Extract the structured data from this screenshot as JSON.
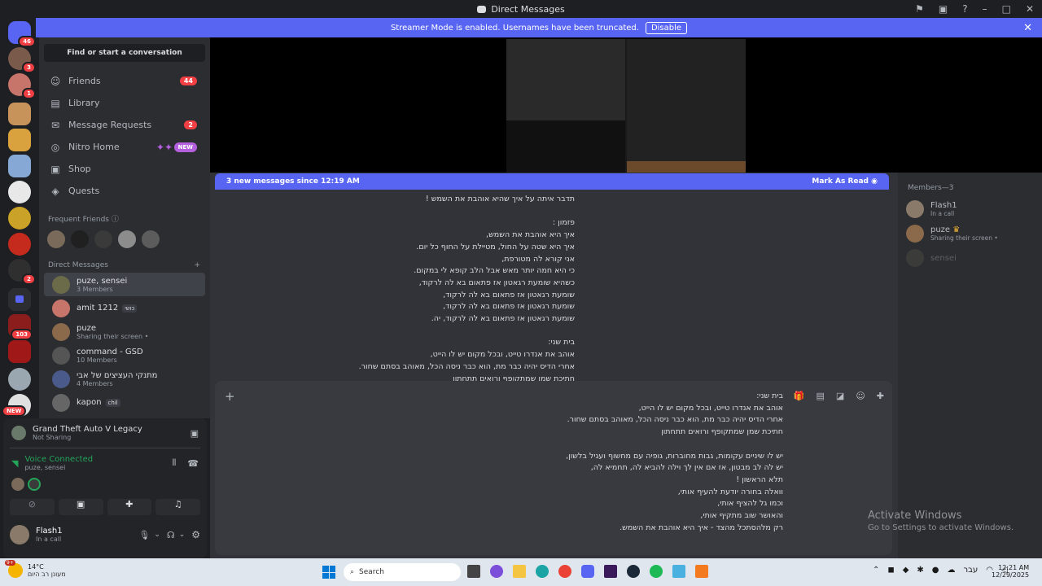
{
  "window": {
    "title": "Direct Messages"
  },
  "banner": {
    "text": "Streamer Mode is enabled. Usernames have been truncated.",
    "button": "Disable"
  },
  "guild_badges": [
    "46",
    "3",
    "1",
    "2",
    "103",
    "NEW"
  ],
  "sidebar": {
    "search_label": "Find or start a conversation",
    "nav": [
      {
        "label": "Friends",
        "icon": "friends-icon",
        "badge": "44"
      },
      {
        "label": "Library",
        "icon": "library-icon"
      },
      {
        "label": "Message Requests",
        "icon": "mail-icon",
        "badge": "2"
      },
      {
        "label": "Nitro Home",
        "icon": "nitro-icon",
        "tag": "NEW"
      },
      {
        "label": "Shop",
        "icon": "shop-icon"
      },
      {
        "label": "Quests",
        "icon": "quests-icon"
      }
    ],
    "frequent_friends_label": "Frequent Friends",
    "direct_messages_label": "Direct Messages",
    "dms": [
      {
        "name": "puze, sensei",
        "sub": "3 Members"
      },
      {
        "name": "amit 1212",
        "tag": "כושי"
      },
      {
        "name": "puze",
        "sub": "Sharing their screen •"
      },
      {
        "name": "command - GSD",
        "sub": "10 Members"
      },
      {
        "name": "מתנקי העציצים של אבי",
        "sub": "4 Members"
      },
      {
        "name": "kapon",
        "tag": "chil"
      }
    ]
  },
  "activity": {
    "game": "Grand Theft Auto V Legacy",
    "status": "Not Sharing"
  },
  "voice": {
    "status": "Voice Connected",
    "channel": "puze, sensei"
  },
  "user": {
    "name": "Flash1",
    "status": "In a call"
  },
  "chat": {
    "new_messages": "3 new messages since 12:19 AM",
    "mark_read": "Mark As Read",
    "lines": [
      "תדבר איתה על איך שהיא אוהבת את השמש !",
      "",
      "פזמון :",
      "איך היא אוהבת את השמש,",
      "איך היא שטה על החול, מטיילת על החוף כל יום.",
      "אני קורא לה מטורפת,",
      "כי היא חמה יותר מאש אבל הלב קופא לי במקום.",
      "כשהיא שומעת רגאטון אז פתאום בא לה לרקוד,",
      "שומעת רגאטון אז פתאום בא לה לרקוד,",
      "שומעת רגאטון אז פתאום בא לה לרקוד,",
      "שומעת רגאטון אז פתאום בא לה לרקוד, יה.",
      "",
      "בית שני:",
      "אוהב את אנדרו טייט, ובכל מקום יש לו הייט,",
      "אחרי הדיס יהיה כבר מת, הוא כבר ניסה הכל, מאוהב בסתם שחור.",
      "חתיכת שמן שמתקופף ורואים תתחתון"
    ]
  },
  "composer": {
    "lines": [
      "בית שני:",
      "אוהב את אנדרו טייט, ובכל מקום יש לו הייט,",
      "אחרי הדיס יהיה כבר מת, הוא כבר ניסה הכל, מאוהב בסתם שחור.",
      "חתיכת שמן שמתקופף ורואים תתחתון",
      "",
      "יש לו שיניים עקומות, גבות מחוברות, גופיה עם מחשוף ועגיל בלשון,",
      "יש לה לב מבטון, אז אם אין לך וילה להביא לה, תחמיא לה,",
      "תלא הראשון !",
      "וואלה בחורה יודעת להעיף אותי,",
      "וכמו גל להציף אותי,",
      "והאושר שוב מתקיף אותי,",
      "רק מלהסתכל מהצד - איך היא אוהבת את השמש."
    ]
  },
  "members": {
    "header": "Members—3",
    "list": [
      {
        "name": "Flash1",
        "status": "In a call"
      },
      {
        "name": "puze",
        "status": "Sharing their screen •"
      },
      {
        "name": "sensei",
        "status": ""
      }
    ]
  },
  "watermark": {
    "title": "Activate Windows",
    "sub": "Go to Settings to activate Windows."
  },
  "taskbar": {
    "weather_temp": "14°C",
    "weather_desc": "מעונן רב היום",
    "weather_badge": "9+",
    "search": "Search",
    "lang": "עבר",
    "time": "12:21 AM",
    "date": "12/29/2025"
  }
}
